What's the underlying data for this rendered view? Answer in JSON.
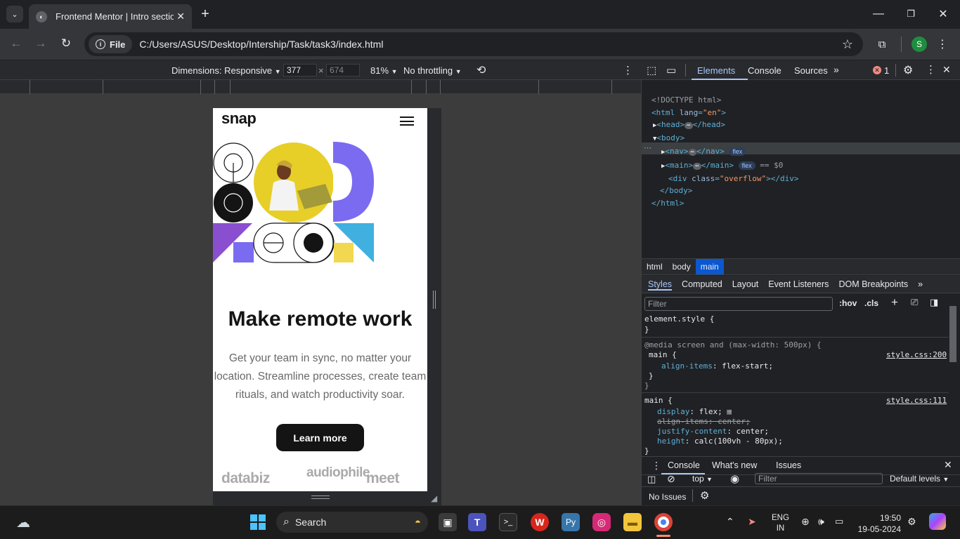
{
  "browser": {
    "tab_title": "Frontend Mentor | Intro section",
    "file_chip": "File",
    "url": "C:/Users/ASUS/Desktop/Intership/Task/task3/index.html",
    "profile_initial": "S"
  },
  "device_toolbar": {
    "dimensions_label": "Dimensions: Responsive",
    "width": "377",
    "height": "674",
    "times": "×",
    "zoom": "81%",
    "throttling": "No throttling"
  },
  "page": {
    "logo": "snap",
    "title": "Make remote work",
    "description": "Get your team in sync, no matter your location. Streamline processes, create team rituals, and watch productivity soar.",
    "cta": "Learn more",
    "clients": [
      "databiz",
      "audiophile",
      "meet"
    ]
  },
  "devtools": {
    "tabs": [
      "Elements",
      "Console",
      "Sources"
    ],
    "error_count": "1",
    "dom": {
      "doctype": "<!DOCTYPE html>",
      "html_open": "<html",
      "lang_attr": "lang",
      "lang_val": "\"en\"",
      "head": "<head>",
      "head_close": "</head>",
      "body": "<body>",
      "nav": "<nav>",
      "nav_close": "</nav>",
      "main": "<main>",
      "main_close": "</main>",
      "flex_badge": "flex",
      "selected_marker": "== $0",
      "div_open": "<div",
      "class_attr": "class",
      "class_val": "\"overflow\"",
      "div_close": "></div>",
      "body_close": "</body>",
      "html_close": "</html>"
    },
    "breadcrumbs": [
      "html",
      "body",
      "main"
    ],
    "styles_tabs": [
      "Styles",
      "Computed",
      "Layout",
      "Event Listeners",
      "DOM Breakpoints"
    ],
    "filter_placeholder": "Filter",
    "hov": ":hov",
    "cls": ".cls",
    "element_style": "element.style {",
    "close_brace": "}",
    "media_query": "@media screen and (max-width: 500px) {",
    "rule1": {
      "selector": "main {",
      "source": "style.css:200",
      "prop": "align-items",
      "value": ": flex-start;"
    },
    "rule2": {
      "selector": "main {",
      "source": "style.css:111",
      "props": [
        {
          "name": "display",
          "value": ": flex;"
        },
        {
          "name": "align-items",
          "value": ": center;"
        },
        {
          "name": "justify-content",
          "value": ": center;"
        },
        {
          "name": "height",
          "value": ": calc(100vh - 80px);"
        }
      ]
    },
    "drawer": {
      "tabs": [
        "Console",
        "What's new",
        "Issues"
      ],
      "context": "top",
      "filter_placeholder": "Filter",
      "levels": "Default levels",
      "no_issues": "No Issues"
    }
  },
  "taskbar": {
    "search": "Search",
    "lang_top": "ENG",
    "lang_bottom": "IN",
    "time": "19:50",
    "date": "19-05-2024"
  }
}
